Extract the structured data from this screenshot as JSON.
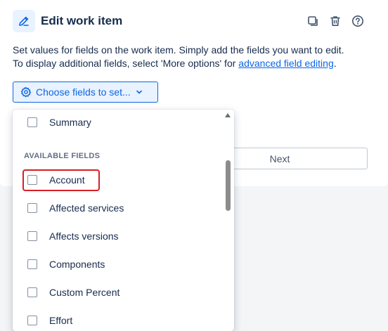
{
  "header": {
    "title": "Edit work item",
    "icons": [
      "edit-pencil-icon",
      "copy-icon",
      "trash-icon",
      "help-icon"
    ]
  },
  "description": {
    "line1": "Set values for fields on the work item. Simply add the fields you want to edit.",
    "line2_before_link": "To display additional fields, select 'More options' for ",
    "link_text": "advanced field editing",
    "line2_after_link": "."
  },
  "choose_button": {
    "label": "Choose fields to set...",
    "icon": "gear-icon",
    "chevron": "chevron-down-icon"
  },
  "next_button": {
    "label": "Next"
  },
  "dropdown": {
    "selected_item": {
      "label": "Summary",
      "checked": false
    },
    "group_heading": "AVAILABLE FIELDS",
    "items": [
      {
        "label": "Account",
        "checked": false
      },
      {
        "label": "Affected services",
        "checked": false
      },
      {
        "label": "Affects versions",
        "checked": false
      },
      {
        "label": "Components",
        "checked": false
      },
      {
        "label": "Custom Percent",
        "checked": false
      },
      {
        "label": "Effort",
        "checked": false
      }
    ]
  },
  "colors": {
    "accent": "#0c66e4",
    "highlight": "#d81f26",
    "text": "#172b4d"
  }
}
